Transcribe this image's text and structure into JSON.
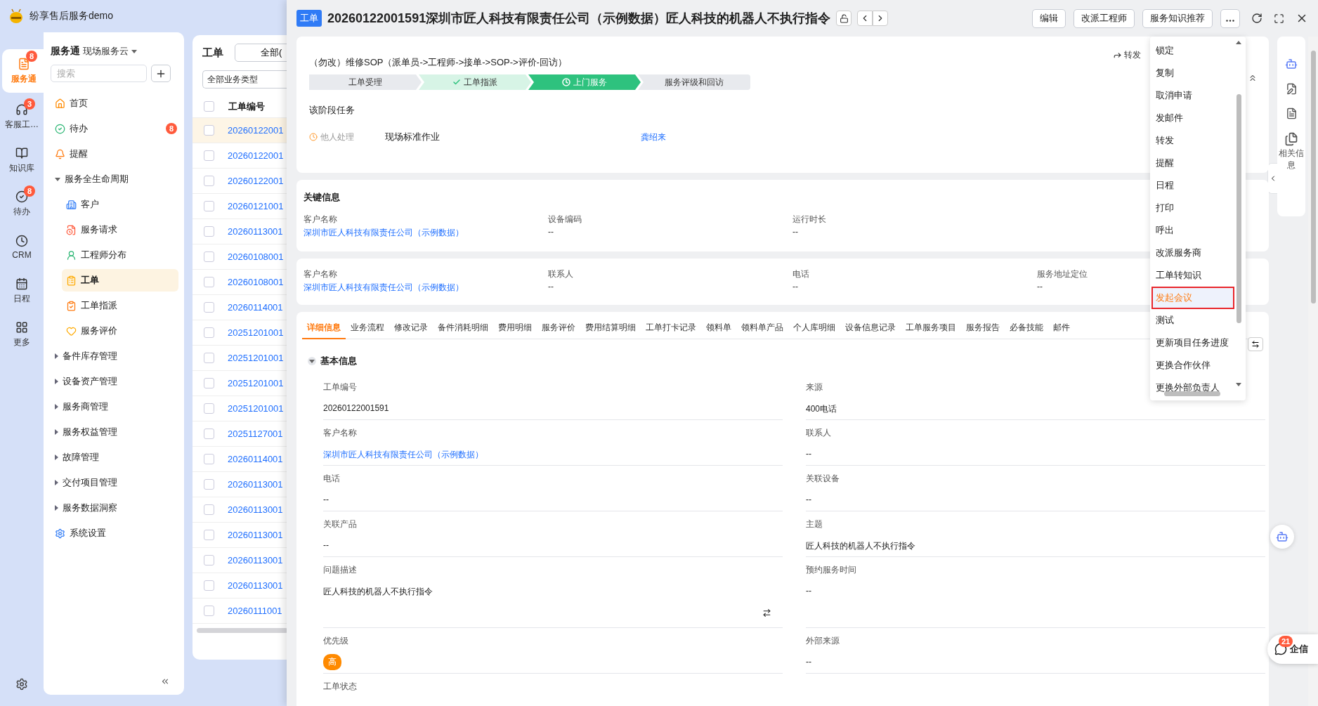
{
  "app": {
    "title": "纷享售后服务demo"
  },
  "rail": {
    "items": [
      {
        "kind": "service",
        "label": "服务通",
        "badge": "8",
        "selected": true
      },
      {
        "kind": "headset",
        "label": "客服工…",
        "badge": "3",
        "selected": false
      },
      {
        "kind": "book",
        "label": "知识库",
        "selected": false
      },
      {
        "kind": "todo",
        "label": "待办",
        "badge": "8",
        "selected": false
      },
      {
        "kind": "crm",
        "label": "CRM",
        "selected": false
      },
      {
        "kind": "calendar",
        "label": "日程",
        "selected": false
      },
      {
        "kind": "more",
        "label": "更多",
        "selected": false
      }
    ]
  },
  "nav": {
    "title": "服务通",
    "subtitle": "现场服务云",
    "search": {
      "placeholder": "搜索"
    },
    "items": [
      {
        "kind": "home",
        "label": "首页",
        "selected": false
      },
      {
        "kind": "todo",
        "label": "待办",
        "badge": "8",
        "selected": false
      },
      {
        "kind": "bell",
        "label": "提醒",
        "selected": false
      },
      {
        "kind": "group",
        "label": "服务全生命周期",
        "expanded": true,
        "children": [
          {
            "kind": "customer",
            "label": "客户",
            "selected": false
          },
          {
            "kind": "request",
            "label": "服务请求",
            "selected": false
          },
          {
            "kind": "engineer",
            "label": "工程师分布",
            "selected": false
          },
          {
            "kind": "order",
            "label": "工单",
            "selected": true
          },
          {
            "kind": "dispatch",
            "label": "工单指派",
            "selected": false
          },
          {
            "kind": "rating",
            "label": "服务评价",
            "selected": false
          }
        ]
      },
      {
        "kind": "group",
        "label": "备件库存管理",
        "expanded": false
      },
      {
        "kind": "group",
        "label": "设备资产管理",
        "expanded": false
      },
      {
        "kind": "group",
        "label": "服务商管理",
        "expanded": false
      },
      {
        "kind": "group",
        "label": "服务权益管理",
        "expanded": false
      },
      {
        "kind": "group",
        "label": "故障管理",
        "expanded": false
      },
      {
        "kind": "group",
        "label": "交付项目管理",
        "expanded": false
      },
      {
        "kind": "group",
        "label": "服务数据洞察",
        "expanded": false
      },
      {
        "kind": "settings",
        "label": "系统设置",
        "selected": false
      }
    ]
  },
  "list": {
    "title": "工单",
    "filter": "全部(",
    "type_select": "全部业务类型",
    "column": "工单编号",
    "all_checked": false,
    "rows": [
      {
        "number": "20260122001",
        "selected": true,
        "checked": false
      },
      {
        "number": "20260122001",
        "selected": false,
        "checked": false
      },
      {
        "number": "20260122001",
        "selected": false,
        "checked": false
      },
      {
        "number": "20260121001",
        "selected": false,
        "checked": false
      },
      {
        "number": "20260113001",
        "selected": false,
        "checked": false
      },
      {
        "number": "20260108001",
        "selected": false,
        "checked": false
      },
      {
        "number": "20260108001",
        "selected": false,
        "checked": false
      },
      {
        "number": "20260114001",
        "selected": false,
        "checked": false
      },
      {
        "number": "20251201001",
        "selected": false,
        "checked": false
      },
      {
        "number": "20251201001",
        "selected": false,
        "checked": false
      },
      {
        "number": "20251201001",
        "selected": false,
        "checked": false
      },
      {
        "number": "20251201001",
        "selected": false,
        "checked": false
      },
      {
        "number": "20251127001",
        "selected": false,
        "checked": false
      },
      {
        "number": "20260114001",
        "selected": false,
        "checked": false
      },
      {
        "number": "20260113001",
        "selected": false,
        "checked": false
      },
      {
        "number": "20260113001",
        "selected": false,
        "checked": false
      },
      {
        "number": "20260113001",
        "selected": false,
        "checked": false
      },
      {
        "number": "20260113001",
        "selected": false,
        "checked": false
      },
      {
        "number": "20260113001",
        "selected": false,
        "checked": false
      },
      {
        "number": "20260111001",
        "selected": false,
        "checked": false
      }
    ]
  },
  "drawer": {
    "badge": "工单",
    "title": "20260122001591深圳市匠人科技有限责任公司（示例数据）匠人科技的机器人不执行指令",
    "actions": [
      "编辑",
      "改派工程师",
      "服务知识推荐"
    ],
    "sop": {
      "title": "（勿改）维修SOP（派单员->工程师->接单->SOP->评价-回访）",
      "forward": "转发",
      "stages": [
        {
          "label": "工单受理",
          "done": false,
          "selected": false
        },
        {
          "label": "工单指派",
          "done": true,
          "selected": false
        },
        {
          "label": "上门服务",
          "done": false,
          "selected": true
        },
        {
          "label": "服务评级和回访",
          "done": false,
          "selected": false
        }
      ],
      "task_heading": "该阶段任务",
      "tasks": [
        {
          "status": "他人处理",
          "name": "现场标准作业",
          "assignee": "龚绍来"
        }
      ]
    },
    "key_info": {
      "title": "关键信息",
      "fields": [
        {
          "label": "客户名称",
          "value": "深圳市匠人科技有限责任公司（示例数据）",
          "kind": "link"
        },
        {
          "label": "设备编码",
          "value": "--",
          "kind": "text"
        },
        {
          "label": "运行时长",
          "value": "--",
          "kind": "text"
        }
      ]
    },
    "summary": {
      "fields": [
        {
          "label": "客户名称",
          "value": "深圳市匠人科技有限责任公司（示例数据）",
          "kind": "link"
        },
        {
          "label": "联系人",
          "value": "--",
          "kind": "text"
        },
        {
          "label": "电话",
          "value": "--",
          "kind": "text"
        },
        {
          "label": "服务地址定位",
          "value": "--",
          "kind": "text"
        }
      ]
    },
    "tabs": [
      {
        "label": "详细信息",
        "selected": true
      },
      {
        "label": "业务流程",
        "selected": false
      },
      {
        "label": "修改记录",
        "selected": false
      },
      {
        "label": "备件消耗明细",
        "selected": false
      },
      {
        "label": "费用明细",
        "selected": false
      },
      {
        "label": "服务评价",
        "selected": false
      },
      {
        "label": "费用结算明细",
        "selected": false
      },
      {
        "label": "工单打卡记录",
        "selected": false
      },
      {
        "label": "领料单",
        "selected": false
      },
      {
        "label": "领料单产品",
        "selected": false
      },
      {
        "label": "个人库明细",
        "selected": false
      },
      {
        "label": "设备信息记录",
        "selected": false
      },
      {
        "label": "工单服务项目",
        "selected": false
      },
      {
        "label": "服务报告",
        "selected": false
      },
      {
        "label": "必备技能",
        "selected": false
      },
      {
        "label": "邮件",
        "selected": false
      }
    ],
    "section": {
      "title": "基本信息",
      "expanded": true,
      "fields": [
        {
          "label": "工单编号",
          "value": "20260122001591",
          "kind": "text"
        },
        {
          "label": "来源",
          "value": "400电话",
          "kind": "text"
        },
        {
          "label": "客户名称",
          "value": "深圳市匠人科技有限责任公司（示例数据）",
          "kind": "link"
        },
        {
          "label": "联系人",
          "value": "--",
          "kind": "text"
        },
        {
          "label": "电话",
          "value": "--",
          "kind": "text"
        },
        {
          "label": "关联设备",
          "value": "--",
          "kind": "text"
        },
        {
          "label": "关联产品",
          "value": "--",
          "kind": "text"
        },
        {
          "label": "主题",
          "value": "匠人科技的机器人不执行指令",
          "kind": "text"
        },
        {
          "label": "问题描述",
          "value": "匠人科技的机器人不执行指令",
          "kind": "multiline"
        },
        {
          "label": "预约服务时间",
          "value": "--",
          "kind": "tall"
        },
        {
          "label": "优先级",
          "value": "高",
          "kind": "tag"
        },
        {
          "label": "外部来源",
          "value": "--",
          "kind": "text"
        },
        {
          "label": "工单状态",
          "kind": "label"
        }
      ]
    }
  },
  "menu": {
    "items": [
      {
        "label": "锁定",
        "selected": false
      },
      {
        "label": "复制",
        "selected": false
      },
      {
        "label": "取消申请",
        "selected": false
      },
      {
        "label": "发邮件",
        "selected": false
      },
      {
        "label": "转发",
        "selected": false
      },
      {
        "label": "提醒",
        "selected": false
      },
      {
        "label": "日程",
        "selected": false
      },
      {
        "label": "打印",
        "selected": false
      },
      {
        "label": "呼出",
        "selected": false
      },
      {
        "label": "改派服务商",
        "selected": false
      },
      {
        "label": "工单转知识",
        "selected": false
      },
      {
        "label": "发起会议",
        "selected": true
      },
      {
        "label": "测试",
        "selected": false
      },
      {
        "label": "更新项目任务进度",
        "selected": false
      },
      {
        "label": "更换合作伙伴",
        "selected": false
      },
      {
        "label": "更换外部负责人",
        "selected": false
      }
    ]
  },
  "side_panel": {
    "label": "相关信息"
  },
  "chat": {
    "label": "企信",
    "badge": "21"
  }
}
